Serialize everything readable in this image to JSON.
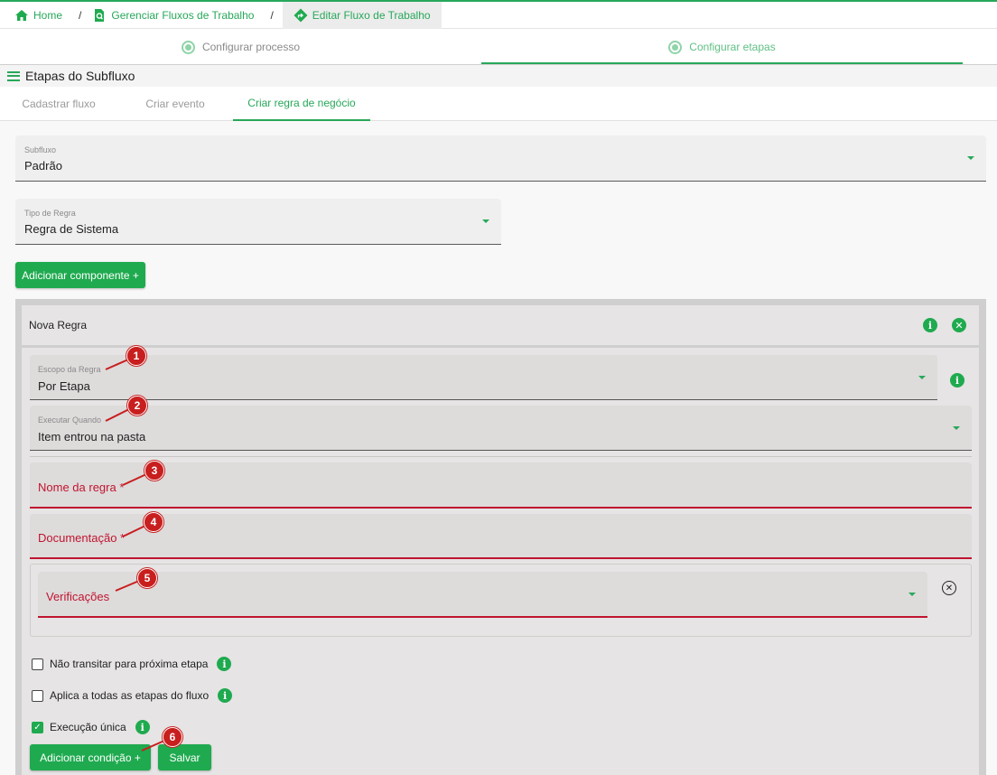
{
  "breadcrumb": {
    "items": [
      {
        "label": "Home",
        "icon": "home-icon"
      },
      {
        "label": "Gerenciar Fluxos de Trabalho",
        "icon": "search-doc-icon"
      },
      {
        "label": "Editar Fluxo de Trabalho",
        "icon": "route-icon"
      }
    ],
    "separator": "/"
  },
  "stepper": {
    "steps": [
      {
        "label": "Configurar processo",
        "active": false
      },
      {
        "label": "Configurar etapas",
        "active": true
      }
    ]
  },
  "section": {
    "title": "Etapas do Subfluxo"
  },
  "tabs": [
    {
      "label": "Cadastrar fluxo",
      "active": false
    },
    {
      "label": "Criar evento",
      "active": false
    },
    {
      "label": "Criar regra de negócio",
      "active": true
    }
  ],
  "form": {
    "subfluxo": {
      "label": "Subfluxo",
      "value": "Padrão"
    },
    "tipo_regra": {
      "label": "Tipo de Regra",
      "value": "Regra de Sistema"
    },
    "add_component_label": "Adicionar componente +"
  },
  "rule": {
    "title": "Nova Regra",
    "escopo": {
      "label": "Escopo da Regra",
      "value": "Por Etapa"
    },
    "executar": {
      "label": "Executar Quando",
      "value": "Item entrou na pasta"
    },
    "nome": {
      "placeholder": "Nome da regra *"
    },
    "documentacao": {
      "placeholder": "Documentação *"
    },
    "verificacoes": {
      "placeholder": "Verificações"
    },
    "checkboxes": [
      {
        "label": "Não transitar para próxima etapa",
        "checked": false
      },
      {
        "label": "Aplica a todas as etapas do fluxo",
        "checked": false
      },
      {
        "label": "Execução única",
        "checked": true
      }
    ],
    "add_condition_label": "Adicionar condição +",
    "save_label": "Salvar"
  },
  "annotations": [
    "1",
    "2",
    "3",
    "4",
    "5",
    "6"
  ],
  "colors": {
    "accent": "#1faa4f",
    "error": "#c0152f",
    "annotation": "#c81e1e"
  }
}
